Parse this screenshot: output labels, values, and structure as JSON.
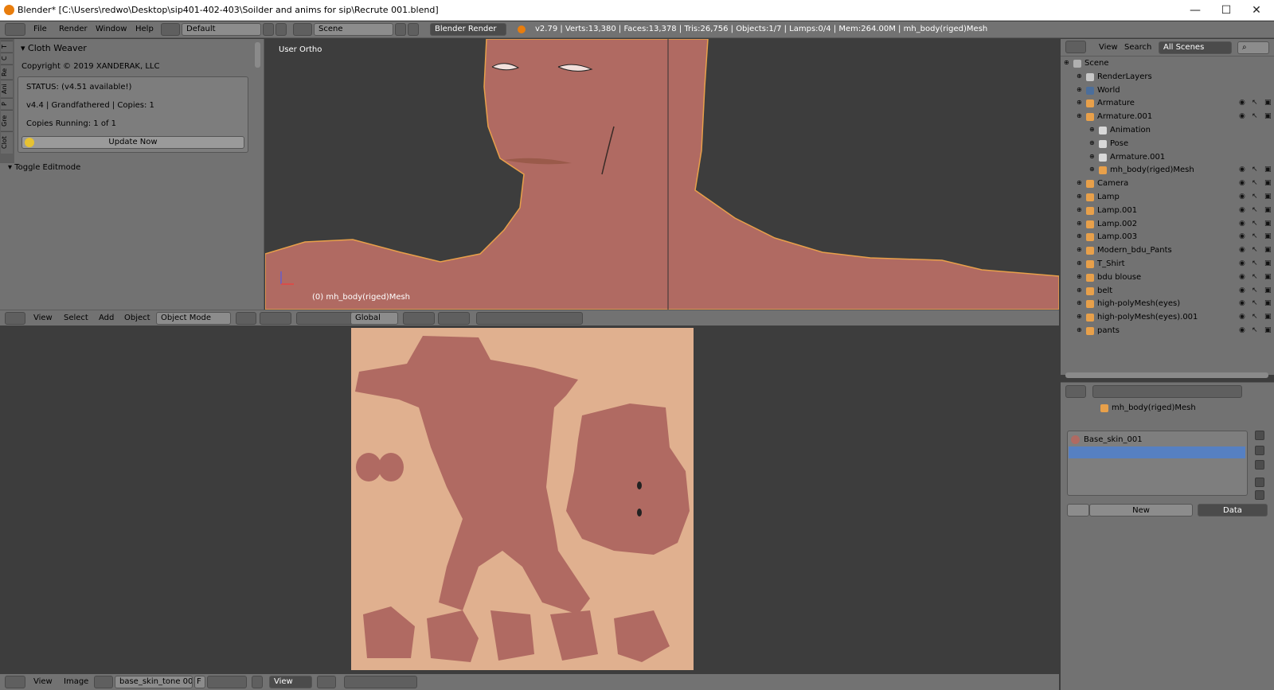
{
  "window": {
    "title": "Blender* [C:\\Users\\redwo\\Desktop\\sip401-402-403\\Soilder and anims for sip\\Recrute 001.blend]",
    "controls": [
      "—",
      "☐",
      "✕"
    ]
  },
  "info_header": {
    "menus": [
      "File",
      "Render",
      "Window",
      "Help"
    ],
    "layout": "Default",
    "scene": "Scene",
    "engine": "Blender Render",
    "stats": "v2.79 | Verts:13,380 | Faces:13,378 | Tris:26,756 | Objects:1/7 | Lamps:0/4 | Mem:264.00M | mh_body(riged)Mesh"
  },
  "tool_tabs": [
    "T",
    "C",
    "Re",
    "Ani",
    "P",
    "Gre",
    "Clot"
  ],
  "cloth_weaver": {
    "header": "Cloth Weaver",
    "copyright": "Copyright © 2019 XANDERAK, LLC",
    "status": "STATUS: (v4.51 available!)",
    "version": "v4.4 | Grandfathered | Copies: 1",
    "running": "Copies Running: 1 of 1",
    "update_button": "Update Now",
    "toggle": "Toggle Editmode"
  },
  "viewport": {
    "view_label": "User Ortho",
    "object_label": "(0) mh_body(riged)Mesh",
    "menus": [
      "View",
      "Select",
      "Add",
      "Object"
    ],
    "mode": "Object Mode",
    "orientation": "Global"
  },
  "image_editor": {
    "menus": [
      "View",
      "Image"
    ],
    "image_name": "base_skin_tone 00...",
    "fake_user": "F",
    "view_mode": "View"
  },
  "outliner": {
    "menus": [
      "View",
      "Search"
    ],
    "display": "All Scenes",
    "items": [
      {
        "label": "Scene",
        "indent": 0,
        "icon": "#b0b0b0",
        "vis": false
      },
      {
        "label": "RenderLayers",
        "indent": 1,
        "icon": "#c8c8c8",
        "vis": false
      },
      {
        "label": "World",
        "indent": 1,
        "icon": "#4b6e9b",
        "vis": false
      },
      {
        "label": "Armature",
        "indent": 1,
        "icon": "#e8a04a",
        "vis": true
      },
      {
        "label": "Armature.001",
        "indent": 1,
        "icon": "#e8a04a",
        "vis": true
      },
      {
        "label": "Animation",
        "indent": 2,
        "icon": "#d8d8d8",
        "vis": false
      },
      {
        "label": "Pose",
        "indent": 2,
        "icon": "#d8d8d8",
        "vis": false
      },
      {
        "label": "Armature.001",
        "indent": 2,
        "icon": "#d8d8d8",
        "vis": false
      },
      {
        "label": "mh_body(riged)Mesh",
        "indent": 2,
        "icon": "#e8a04a",
        "vis": true
      },
      {
        "label": "Camera",
        "indent": 1,
        "icon": "#e8a04a",
        "vis": true
      },
      {
        "label": "Lamp",
        "indent": 1,
        "icon": "#e8a04a",
        "vis": true
      },
      {
        "label": "Lamp.001",
        "indent": 1,
        "icon": "#e8a04a",
        "vis": true
      },
      {
        "label": "Lamp.002",
        "indent": 1,
        "icon": "#e8a04a",
        "vis": true
      },
      {
        "label": "Lamp.003",
        "indent": 1,
        "icon": "#e8a04a",
        "vis": true
      },
      {
        "label": "Modern_bdu_Pants",
        "indent": 1,
        "icon": "#e8a04a",
        "vis": true
      },
      {
        "label": "T_Shirt",
        "indent": 1,
        "icon": "#e8a04a",
        "vis": true
      },
      {
        "label": "bdu blouse",
        "indent": 1,
        "icon": "#e8a04a",
        "vis": true
      },
      {
        "label": "belt",
        "indent": 1,
        "icon": "#e8a04a",
        "vis": true
      },
      {
        "label": "high-polyMesh(eyes)",
        "indent": 1,
        "icon": "#e8a04a",
        "vis": true
      },
      {
        "label": "high-polyMesh(eyes).001",
        "indent": 1,
        "icon": "#e8a04a",
        "vis": true
      },
      {
        "label": "pants",
        "indent": 1,
        "icon": "#e8a04a",
        "vis": true
      }
    ]
  },
  "properties": {
    "breadcrumb": "mh_body(riged)Mesh",
    "material_slot": "Base_skin_001",
    "new_button": "New",
    "data_dropdown": "Data"
  },
  "colors": {
    "skin": "#b06a62",
    "uv_background": "#e0b08f",
    "selection": "#5680c2",
    "outline": "#e8a04a"
  }
}
